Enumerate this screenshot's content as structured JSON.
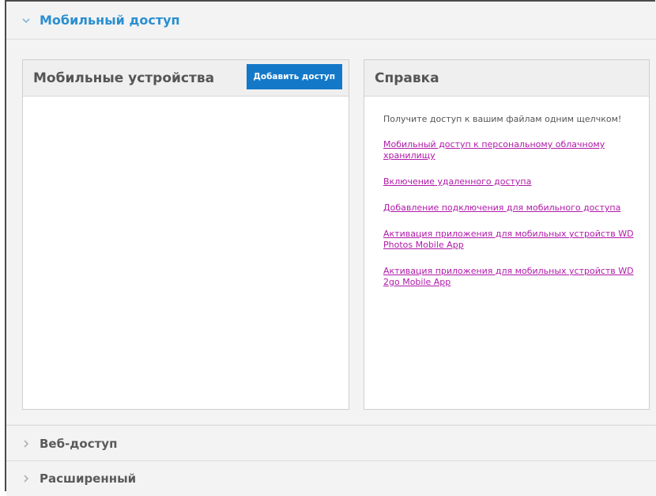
{
  "sections": {
    "mobile": {
      "title": "Мобильный доступ",
      "devices_panel": {
        "title": "Мобильные устройства",
        "add_button": "Добавить доступ"
      },
      "help_panel": {
        "title": "Справка",
        "intro": "Получите доступ к вашим файлам одним щелчком!",
        "links": [
          "Мобильный доступ к персональному облачному хранилищу",
          "Включение удаленного доступа",
          "Добавление подключения для мобильного доступа",
          "Активация приложения для мобильных устройств WD Photos Mobile App",
          "Активация приложения для мобильных устройств WD 2go Mobile App"
        ]
      }
    },
    "web": {
      "title": "Веб-доступ"
    },
    "advanced": {
      "title": "Расширенный"
    }
  },
  "colors": {
    "accent": "#2a8fd0",
    "button": "#1478c8",
    "link": "#b01aa8"
  },
  "icons": {
    "expanded": "chevron-down-icon",
    "collapsed": "chevron-right-icon"
  }
}
